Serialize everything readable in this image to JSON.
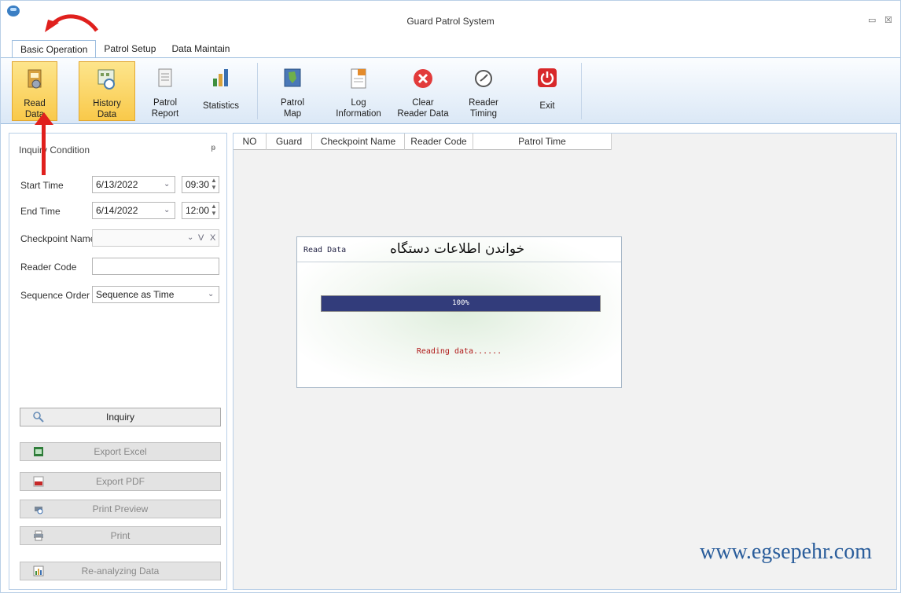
{
  "window": {
    "title": "Guard Patrol System",
    "minimize": "▭",
    "close": "☒"
  },
  "tabs": [
    "Basic Operation",
    "Patrol Setup",
    "Data Maintain"
  ],
  "ribbon": [
    {
      "label": "Read\nData",
      "icon": "read-data-icon"
    },
    {
      "label": "History\nData",
      "icon": "history-data-icon"
    },
    {
      "label": "Patrol\nReport",
      "icon": "patrol-report-icon"
    },
    {
      "label": "Statistics",
      "icon": "statistics-icon"
    },
    {
      "label": "Patrol\nMap",
      "icon": "patrol-map-icon"
    },
    {
      "label": "Log\nInformation",
      "icon": "log-icon"
    },
    {
      "label": "Clear\nReader Data",
      "icon": "clear-icon"
    },
    {
      "label": "Reader\nTiming",
      "icon": "timing-icon"
    },
    {
      "label": "Exit",
      "icon": "exit-icon"
    }
  ],
  "inquiry": {
    "title": "Inquiry Condition",
    "pin": "ᵽ",
    "start_label": "Start Time",
    "start_date": "6/13/2022",
    "start_time": "09:30",
    "end_label": "End Time",
    "end_date": "6/14/2022",
    "end_time": "12:00",
    "checkpoint_label": "Checkpoint Name",
    "checkpoint_value": "",
    "reader_label": "Reader Code",
    "reader_value": "",
    "order_label": "Sequence Order",
    "order_value": "Sequence as Time",
    "v_btn": "V",
    "x_btn": "X"
  },
  "actions": [
    {
      "label": "Inquiry",
      "enabled": true
    },
    {
      "label": "Export Excel",
      "enabled": false
    },
    {
      "label": "Export PDF",
      "enabled": false
    },
    {
      "label": "Print Preview",
      "enabled": false
    },
    {
      "label": "Print",
      "enabled": false
    },
    {
      "label": "Re-analyzing Data",
      "enabled": false
    }
  ],
  "table_headers": [
    "NO",
    "Guard",
    "Checkpoint Name",
    "Reader Code",
    "Patrol Time"
  ],
  "dialog": {
    "title": "Read Data",
    "persian_title": "خواندن اطلاعات دستگاه",
    "progress_text": "100%",
    "progress": 1.0,
    "status": "Reading data......"
  },
  "watermark": "www.egsepehr.com",
  "colors": {
    "progress": "#323c7b",
    "accent_active": "#f9c94a",
    "annotation": "#e0201d",
    "watermark": "#2a5d9b"
  }
}
